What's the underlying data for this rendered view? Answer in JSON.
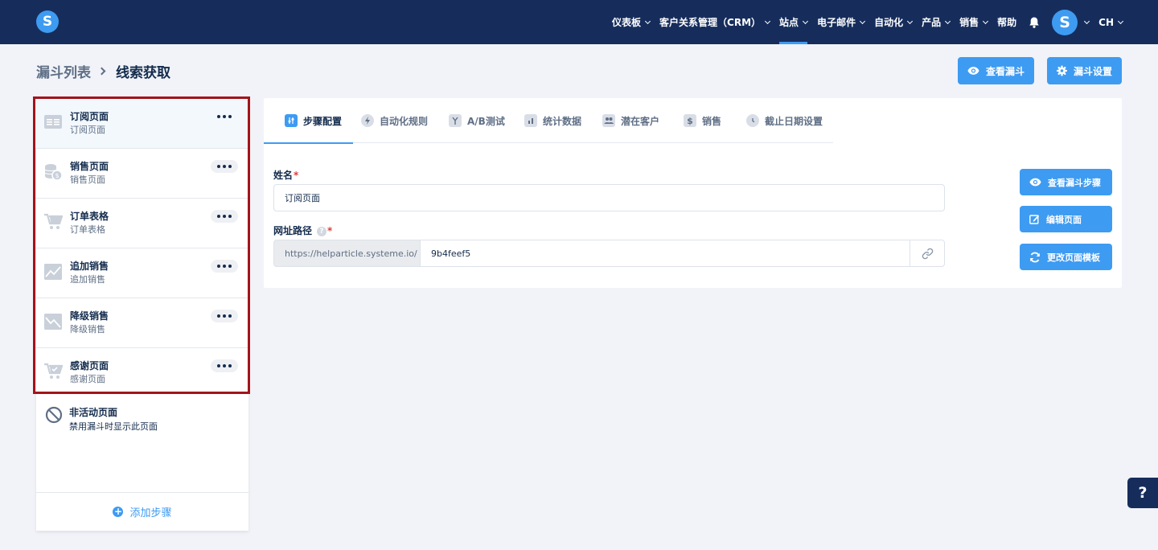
{
  "app": {
    "logo_letter": "S"
  },
  "nav": {
    "items": [
      {
        "label": "仪表板",
        "chevron": true,
        "active": false
      },
      {
        "label": "客户关系管理（CRM）",
        "chevron": true,
        "active": false
      },
      {
        "label": "站点",
        "chevron": true,
        "active": true
      },
      {
        "label": "电子邮件",
        "chevron": true,
        "active": false
      },
      {
        "label": "自动化",
        "chevron": true,
        "active": false
      },
      {
        "label": "产品",
        "chevron": true,
        "active": false
      },
      {
        "label": "销售",
        "chevron": true,
        "active": false
      },
      {
        "label": "帮助",
        "chevron": false,
        "active": false
      }
    ],
    "avatar_letter": "S",
    "language": "CH"
  },
  "breadcrumb": {
    "root": "漏斗列表",
    "current": "线索获取"
  },
  "header_buttons": {
    "view_funnel": "查看漏斗",
    "funnel_settings": "漏斗设置"
  },
  "sidebar": {
    "steps": [
      {
        "title": "订阅页面",
        "subtitle": "订阅页面",
        "icon": "optin-page-icon",
        "active": true
      },
      {
        "title": "销售页面",
        "subtitle": "销售页面",
        "icon": "sales-page-icon",
        "active": false
      },
      {
        "title": "订单表格",
        "subtitle": "订单表格",
        "icon": "order-form-icon",
        "active": false
      },
      {
        "title": "追加销售",
        "subtitle": "追加销售",
        "icon": "upsell-icon",
        "active": false
      },
      {
        "title": "降级销售",
        "subtitle": "降级销售",
        "icon": "downsell-icon",
        "active": false
      },
      {
        "title": "感谢页面",
        "subtitle": "感谢页面",
        "icon": "thank-you-icon",
        "active": false
      }
    ],
    "inactive": {
      "title": "非活动页面",
      "subtitle": "禁用漏斗时显示此页面"
    },
    "add_step": "添加步骤"
  },
  "tabs": [
    {
      "label": "步骤配置",
      "icon": "sliders-icon",
      "active": true
    },
    {
      "label": "自动化规则",
      "icon": "lightning-icon",
      "active": false
    },
    {
      "label": "A/B测试",
      "icon": "split-icon",
      "active": false
    },
    {
      "label": "统计数据",
      "icon": "bar-chart-icon",
      "active": false
    },
    {
      "label": "潜在客户",
      "icon": "users-icon",
      "active": false
    },
    {
      "label": "销售",
      "icon": "dollar-icon",
      "active": false
    },
    {
      "label": "截止日期设置",
      "icon": "clock-icon",
      "active": false
    }
  ],
  "form": {
    "name_label": "姓名",
    "name_value": "订阅页面",
    "path_label": "网址路径",
    "path_prefix": "https://helparticle.systeme.io/",
    "path_value": "9b4feef5",
    "required_mark": "*"
  },
  "actions": {
    "view_step": "查看漏斗步骤",
    "edit_page": "编辑页面",
    "change_template": "更改页面模板"
  },
  "help_fab": "?",
  "colors": {
    "nav_bg": "#162d5c",
    "accent": "#3e9bf2",
    "highlight": "#a3141b",
    "page_bg": "#f1f3f8"
  }
}
